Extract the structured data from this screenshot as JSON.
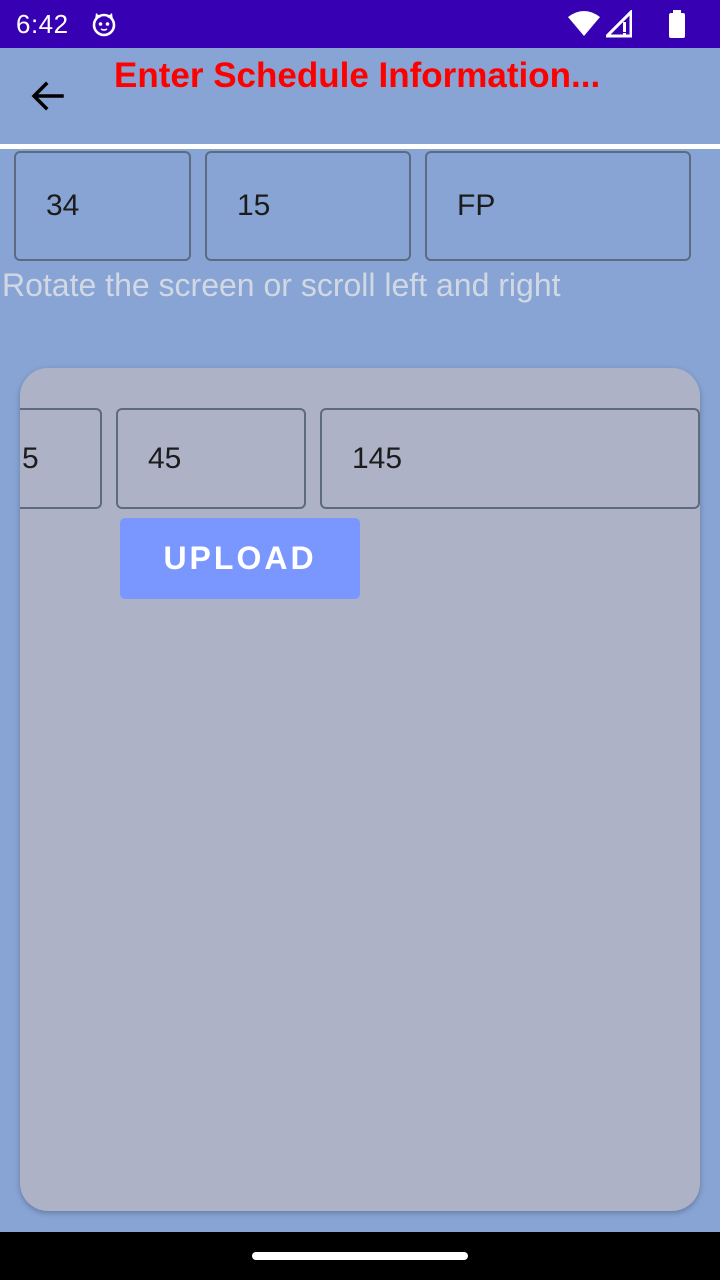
{
  "status_bar": {
    "time": "6:42",
    "icons": [
      "cat-icon",
      "wifi-icon",
      "signal-icon",
      "battery-icon"
    ]
  },
  "app_bar": {
    "title": "Enter Schedule Information...",
    "back_icon": "arrow-left-icon"
  },
  "row1": {
    "field_1": "34",
    "field_2": "15",
    "field_3": "FP"
  },
  "hint": "Rotate the screen or scroll left and right",
  "card": {
    "field_1": "5",
    "field_2": "45",
    "field_3": "145",
    "upload_label": "UPLOAD"
  },
  "colors": {
    "status_bar": "#3700b3",
    "background": "#87a4d4",
    "title": "#ff0000",
    "card": "#adb2c6",
    "upload_button": "#7a97ff"
  }
}
